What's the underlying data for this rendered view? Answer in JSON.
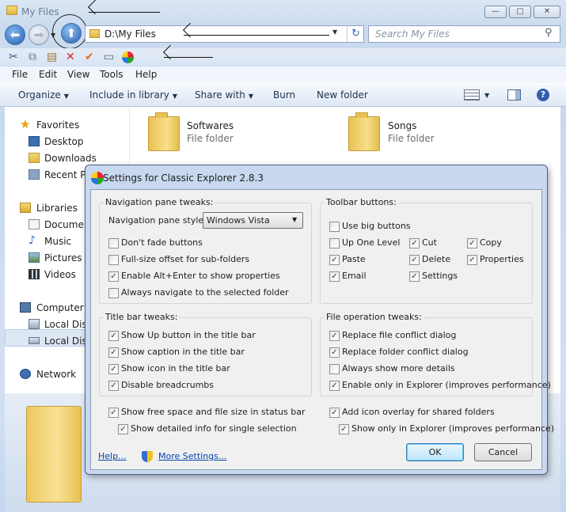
{
  "window": {
    "title": "My Files",
    "buttons": {
      "min": "—",
      "max": "▢",
      "close": "✕"
    }
  },
  "nav": {
    "address": "D:\\My Files",
    "search_placeholder": "Search My Files",
    "back_glyph": "⬅",
    "forward_glyph": "➡",
    "up_glyph": "⬆",
    "dropdown_glyph": "▼",
    "refresh_glyph": "↻",
    "search_glyph": "⚲"
  },
  "toolbar_icons": [
    "cut-icon",
    "copy-icon",
    "paste-icon",
    "delete-icon",
    "check-icon",
    "properties-icon",
    "settings-icon"
  ],
  "menu": [
    "File",
    "Edit",
    "View",
    "Tools",
    "Help"
  ],
  "commands": [
    "Organize",
    "Include in library",
    "Share with",
    "Burn",
    "New folder"
  ],
  "navpane": {
    "favorites": "Favorites",
    "fav_items": [
      "Desktop",
      "Downloads",
      "Recent Pl"
    ],
    "libraries": "Libraries",
    "lib_items": [
      "Documen",
      "Music",
      "Pictures",
      "Videos"
    ],
    "computer": "Computer",
    "comp_items": [
      "Local Disk",
      "Local Disk"
    ],
    "network": "Network"
  },
  "files": [
    {
      "name": "Softwares",
      "type": "File folder"
    },
    {
      "name": "Songs",
      "type": "File folder"
    }
  ],
  "dialog": {
    "title": "Settings for Classic Explorer 2.8.3",
    "nav_group": {
      "title": "Navigation pane tweaks:",
      "style_label": "Navigation pane style:",
      "style_value": "Windows Vista",
      "options": [
        {
          "label": "Don't fade buttons",
          "checked": false
        },
        {
          "label": "Full-size offset for sub-folders",
          "checked": false
        },
        {
          "label": "Enable Alt+Enter to show properties",
          "checked": true
        },
        {
          "label": "Always navigate to the selected folder",
          "checked": false
        }
      ]
    },
    "toolbar_group": {
      "title": "Toolbar buttons:",
      "big": {
        "label": "Use big buttons",
        "checked": false
      },
      "col1": [
        {
          "label": "Up One Level",
          "checked": false
        },
        {
          "label": "Paste",
          "checked": true
        },
        {
          "label": "Email",
          "checked": true
        }
      ],
      "col2": [
        {
          "label": "Cut",
          "checked": true
        },
        {
          "label": "Delete",
          "checked": true
        },
        {
          "label": "Settings",
          "checked": true
        }
      ],
      "col3": [
        {
          "label": "Copy",
          "checked": true
        },
        {
          "label": "Properties",
          "checked": true
        }
      ]
    },
    "title_group": {
      "title": "Title bar tweaks:",
      "options": [
        {
          "label": "Show Up button in the title bar",
          "checked": true
        },
        {
          "label": "Show caption in the title bar",
          "checked": true
        },
        {
          "label": "Show icon in the title bar",
          "checked": true
        },
        {
          "label": "Disable breadcrumbs",
          "checked": true
        }
      ]
    },
    "file_group": {
      "title": "File operation tweaks:",
      "options": [
        {
          "label": "Replace file conflict dialog",
          "checked": true
        },
        {
          "label": "Replace folder conflict dialog",
          "checked": true
        },
        {
          "label": "Always show more details",
          "checked": false
        },
        {
          "label": "Enable only in Explorer (improves performance)",
          "checked": true
        }
      ]
    },
    "bottom_left": [
      {
        "label": "Show free space and file size in status bar",
        "checked": true
      },
      {
        "label": "Show detailed info for single selection",
        "checked": true
      }
    ],
    "bottom_right": [
      {
        "label": "Add icon overlay for shared folders",
        "checked": true
      },
      {
        "label": "Show only in Explorer (improves performance)",
        "checked": true
      }
    ],
    "help_link": "Help...",
    "more_settings_link": "More Settings...",
    "ok": "OK",
    "cancel": "Cancel",
    "check_glyph": "✓"
  }
}
